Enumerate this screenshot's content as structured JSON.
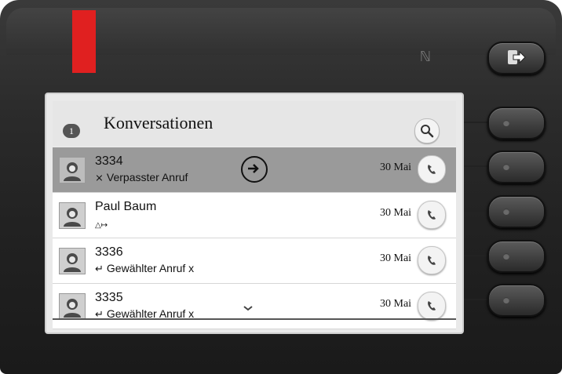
{
  "header": {
    "badge": "1",
    "title": "Konversationen"
  },
  "conversations": [
    {
      "name": "3334",
      "subtitle": "Verpasster Anruf",
      "status_icon": "missed-call-icon",
      "status_glyph": "⨯",
      "date": "30 Mai",
      "selected": true
    },
    {
      "name": "Paul Baum",
      "subtitle": "",
      "status_icon": "forwarded-icon",
      "status_glyph": "△↦",
      "date": "30 Mai",
      "selected": false
    },
    {
      "name": "3336",
      "subtitle": "Gewählter Anruf x",
      "status_icon": "dialed-call-icon",
      "status_glyph": "↵",
      "date": "30 Mai",
      "selected": false
    },
    {
      "name": "3335",
      "subtitle": "Gewählter Anruf x",
      "status_icon": "dialed-call-icon",
      "status_glyph": "↵",
      "date": "30 Mai",
      "selected": false
    }
  ],
  "colors": {
    "led": "#e02020",
    "selected_row": "#9a9a9a",
    "bezel": "#2b2b2b"
  }
}
